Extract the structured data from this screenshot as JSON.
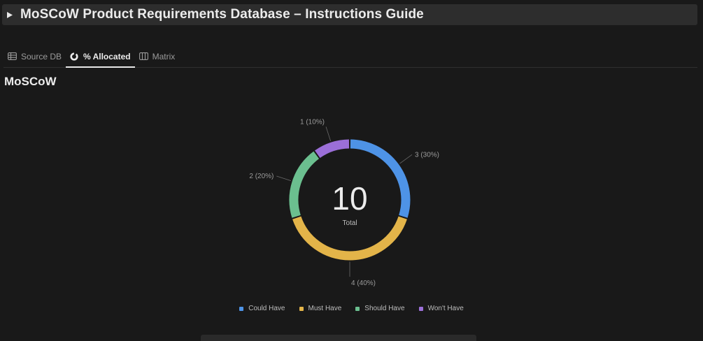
{
  "header": {
    "title": "MoSCoW Product Requirements Database – Instructions Guide"
  },
  "tabs": [
    {
      "label": "Source DB",
      "icon": "table-icon",
      "active": false
    },
    {
      "label": "% Allocated",
      "icon": "donut-chart-icon",
      "active": true
    },
    {
      "label": "Matrix",
      "icon": "columns-icon",
      "active": false
    }
  ],
  "view": {
    "title": "MoSCoW"
  },
  "chart_data": {
    "type": "pie",
    "variant": "donut",
    "center_value": "10",
    "center_label": "Total",
    "categories": [
      "Could Have",
      "Must Have",
      "Should Have",
      "Won't Have"
    ],
    "values": [
      3,
      4,
      2,
      1
    ],
    "labels": [
      "3 (30%)",
      "4 (40%)",
      "2 (20%)",
      "1 (10%)"
    ],
    "colors": [
      "#4e93e6",
      "#e3b449",
      "#6bbf8f",
      "#9b6fd8"
    ],
    "legend_position": "bottom"
  },
  "colors": {
    "background": "#191919",
    "header_background": "#2d2d2d",
    "text": "#ececec",
    "muted_text": "#9b9b9b"
  }
}
